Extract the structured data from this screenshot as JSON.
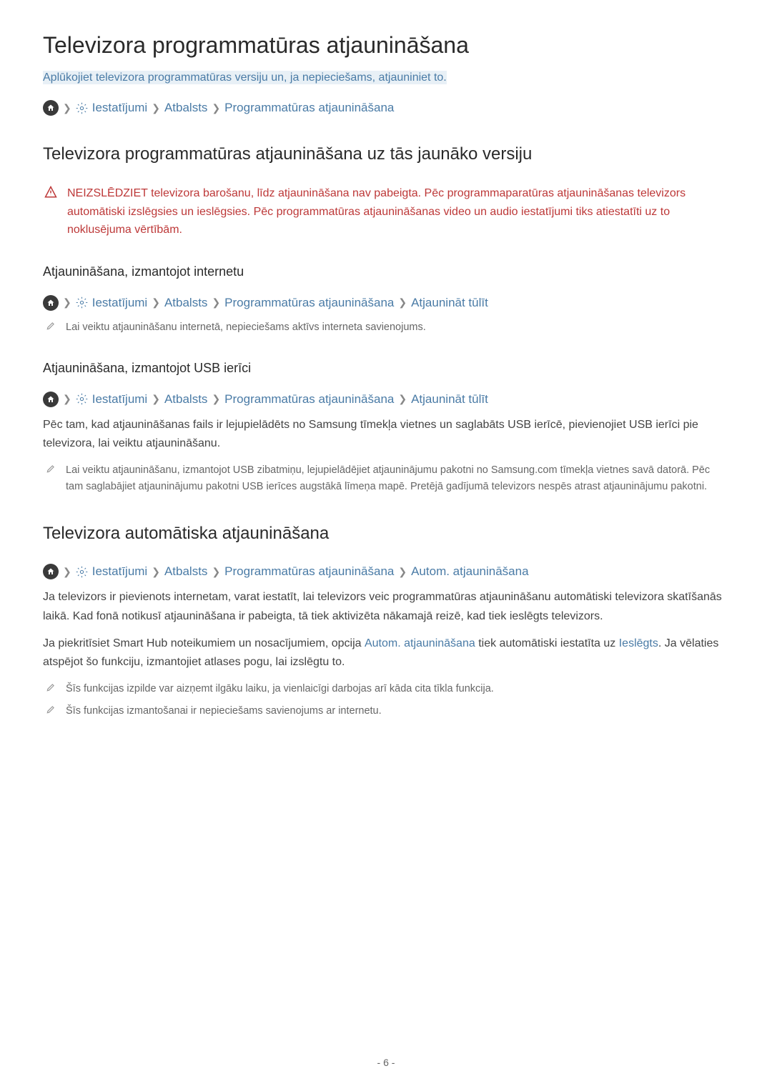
{
  "title": "Televizora programmatūras atjaunināšana",
  "intro": "Aplūkojiet televizora programmatūras versiju un, ja nepieciešams, atjauniniet to.",
  "bc1": {
    "settings": "Iestatījumi",
    "support": "Atbalsts",
    "sw": "Programmatūras atjaunināšana"
  },
  "section1": {
    "heading": "Televizora programmatūras atjaunināšana uz tās jaunāko versiju",
    "warning": "NEIZSLĒDZIET televizora barošanu, līdz atjaunināšana nav pabeigta. Pēc programmaparatūras atjaunināšanas televizors automātiski izslēgsies un ieslēgsies. Pēc programmatūras atjaunināšanas video un audio iestatījumi tiks atiestatīti uz to noklusējuma vērtībām."
  },
  "section2": {
    "heading": "Atjaunināšana, izmantojot internetu",
    "bc": {
      "settings": "Iestatījumi",
      "support": "Atbalsts",
      "sw": "Programmatūras atjaunināšana",
      "now": "Atjaunināt tūlīt"
    },
    "note": "Lai veiktu atjaunināšanu internetā, nepieciešams aktīvs interneta savienojums."
  },
  "section3": {
    "heading": "Atjaunināšana, izmantojot USB ierīci",
    "bc": {
      "settings": "Iestatījumi",
      "support": "Atbalsts",
      "sw": "Programmatūras atjaunināšana",
      "now": "Atjaunināt tūlīt"
    },
    "body": "Pēc tam, kad atjaunināšanas fails ir lejupielādēts no Samsung tīmekļa vietnes un saglabāts USB ierīcē, pievienojiet USB ierīci pie televizora, lai veiktu atjaunināšanu.",
    "note": "Lai veiktu atjaunināšanu, izmantojot USB zibatmiņu, lejupielādējiet atjauninājumu pakotni no Samsung.com tīmekļa vietnes savā datorā. Pēc tam saglabājiet atjauninājumu pakotni USB ierīces augstākā līmeņa mapē. Pretējā gadījumā televizors nespēs atrast atjauninājumu pakotni."
  },
  "section4": {
    "heading": "Televizora automātiska atjaunināšana",
    "bc": {
      "settings": "Iestatījumi",
      "support": "Atbalsts",
      "sw": "Programmatūras atjaunināšana",
      "auto": "Autom. atjaunināšana"
    },
    "body1": "Ja televizors ir pievienots internetam, varat iestatīt, lai televizors veic programmatūras atjaunināšanu automātiski televizora skatīšanās laikā. Kad fonā notikusī atjaunināšana ir pabeigta, tā tiek aktivizēta nākamajā reizē, kad tiek ieslēgts televizors.",
    "body2_a": "Ja piekritīsiet Smart Hub noteikumiem un nosacījumiem, opcija ",
    "body2_link1": "Autom. atjaunināšana",
    "body2_b": " tiek automātiski iestatīta uz ",
    "body2_link2": "Ieslēgts",
    "body2_c": ". Ja vēlaties atspējot šo funkciju, izmantojiet atlases pogu, lai izslēgtu to.",
    "note1": "Šīs funkcijas izpilde var aizņemt ilgāku laiku, ja vienlaicīgi darbojas arī kāda cita tīkla funkcija.",
    "note2": "Šīs funkcijas izmantošanai ir nepieciešams savienojums ar internetu."
  },
  "page": "- 6 -"
}
